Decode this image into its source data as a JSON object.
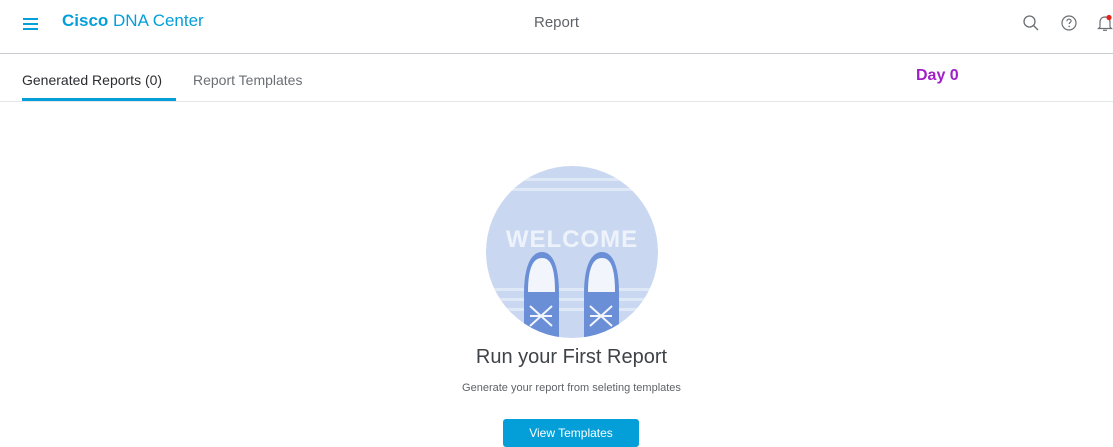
{
  "header": {
    "brand_bold": "Cisco",
    "brand_rest": " DNA Center",
    "title": "Report",
    "icons": [
      "menu-icon",
      "search-icon",
      "help-icon",
      "notification-bell-icon"
    ],
    "accent_color": "#049fd9",
    "notification_dot_color": "#e2231a"
  },
  "tabs": [
    {
      "label": "Generated Reports (0)",
      "active": true
    },
    {
      "label": "Report Templates",
      "active": false
    }
  ],
  "annotation": {
    "label": "Day 0",
    "color": "#a11fc7"
  },
  "empty_state": {
    "illustration_text": "WELCOME",
    "title": "Run your First Report",
    "subtitle": "Generate your report from seleting templates",
    "button_label": "View Templates"
  }
}
